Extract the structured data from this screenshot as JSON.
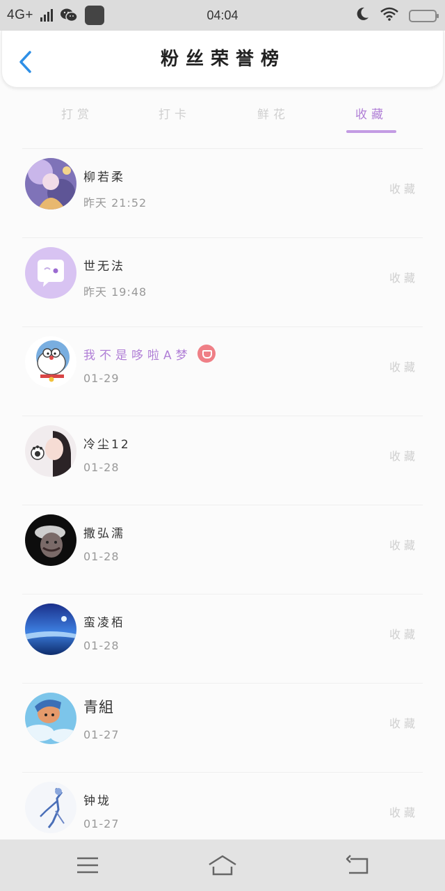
{
  "status_bar": {
    "network": "4G+",
    "time": "04:04"
  },
  "header": {
    "title": "粉丝荣誉榜"
  },
  "tabs": [
    {
      "label": "打赏",
      "active": false
    },
    {
      "label": "打卡",
      "active": false
    },
    {
      "label": "鲜花",
      "active": false
    },
    {
      "label": "收藏",
      "active": true
    }
  ],
  "colors": {
    "accent": "#b07fd6",
    "back_arrow": "#2e8fe6",
    "vip_badge": "#ef7f86"
  },
  "list": [
    {
      "name": "柳若柔",
      "date": "昨天 21:52",
      "action": "收藏",
      "avatar": "anime-girl-avatar"
    },
    {
      "name": "世无法",
      "date": "昨天 19:48",
      "action": "收藏",
      "avatar": "chat-bubble-avatar"
    },
    {
      "name": "我不是哆啦A梦",
      "date": "01-29",
      "action": "收藏",
      "avatar": "doraemon-avatar",
      "vip": true
    },
    {
      "name": "冷尘12",
      "date": "01-28",
      "action": "收藏",
      "avatar": "girl-photo-avatar"
    },
    {
      "name": "撒弘濡",
      "date": "01-28",
      "action": "收藏",
      "avatar": "hat-man-avatar"
    },
    {
      "name": "蛮凌栢",
      "date": "01-28",
      "action": "收藏",
      "avatar": "ocean-avatar"
    },
    {
      "name": "青組",
      "date": "01-27",
      "action": "收藏",
      "avatar": "cartoon-avatar"
    },
    {
      "name": "钟垅",
      "date": "01-27",
      "action": "收藏",
      "avatar": "sketch-figure-avatar"
    }
  ],
  "nav": {
    "menu_icon": "menu-icon",
    "home_icon": "home-icon",
    "back_icon": "back-icon"
  }
}
